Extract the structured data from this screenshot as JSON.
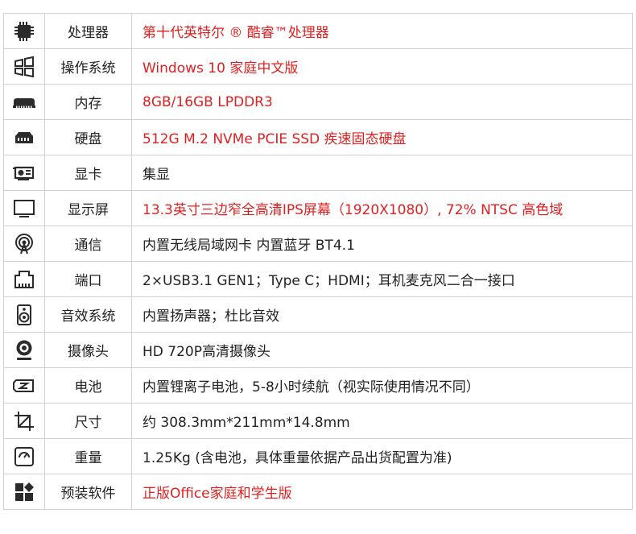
{
  "rows": [
    {
      "key": "cpu",
      "icon": "cpu-chip-icon",
      "label": "处理器",
      "value": "第十代英特尔 ® 酷睿™处理器",
      "color": "#e02020"
    },
    {
      "key": "os",
      "icon": "windows-logo-icon",
      "label": "操作系统",
      "value": "Windows 10 家庭中文版",
      "color": "#e02020"
    },
    {
      "key": "memory",
      "icon": "memory-stick-icon",
      "label": "内存",
      "value": "8GB/16GB LPDDR3",
      "color": "#e02020"
    },
    {
      "key": "storage",
      "icon": "hard-drive-icon",
      "label": "硬盘",
      "value": "512G M.2 NVMe PCIE SSD 疾速固态硬盘",
      "color": "#e02020"
    },
    {
      "key": "gpu",
      "icon": "graphics-card-icon",
      "label": "显卡",
      "value": "集显",
      "color": "#222222"
    },
    {
      "key": "display",
      "icon": "monitor-icon",
      "label": "显示屏",
      "value": "13.3英寸三边窄全高清IPS屏幕（1920X1080）, 72% NTSC 高色域",
      "color": "#e02020"
    },
    {
      "key": "wireless",
      "icon": "wireless-signal-icon",
      "label": "通信",
      "value": "内置无线局域网卡  内置蓝牙   BT4.1",
      "color": "#222222"
    },
    {
      "key": "ports",
      "icon": "ethernet-port-icon",
      "label": "端口",
      "value": "2×USB3.1 GEN1；Type C；HDMI；耳机麦克风二合一接口",
      "color": "#222222"
    },
    {
      "key": "audio",
      "icon": "speaker-icon",
      "label": "音效系统",
      "value": "内置扬声器；杜比音效",
      "color": "#222222"
    },
    {
      "key": "camera",
      "icon": "webcam-icon",
      "label": "摄像头",
      "value": "HD 720P高清摄像头",
      "color": "#222222"
    },
    {
      "key": "battery",
      "icon": "battery-icon",
      "label": "电池",
      "value": "内置锂离子电池，5-8小时续航（视实际使用情况不同）",
      "color": "#222222"
    },
    {
      "key": "size",
      "icon": "crop-dimensions-icon",
      "label": "尺寸",
      "value": "约 308.3mm*211mm*14.8mm",
      "color": "#222222"
    },
    {
      "key": "weight",
      "icon": "weight-scale-icon",
      "label": "重量",
      "value": "1.25Kg (含电池，具体重量依据产品出货配置为准)",
      "color": "#222222"
    },
    {
      "key": "software",
      "icon": "apps-grid-icon",
      "label": "预装软件",
      "value": "正版Office家庭和学生版",
      "color": "#e02020"
    }
  ]
}
